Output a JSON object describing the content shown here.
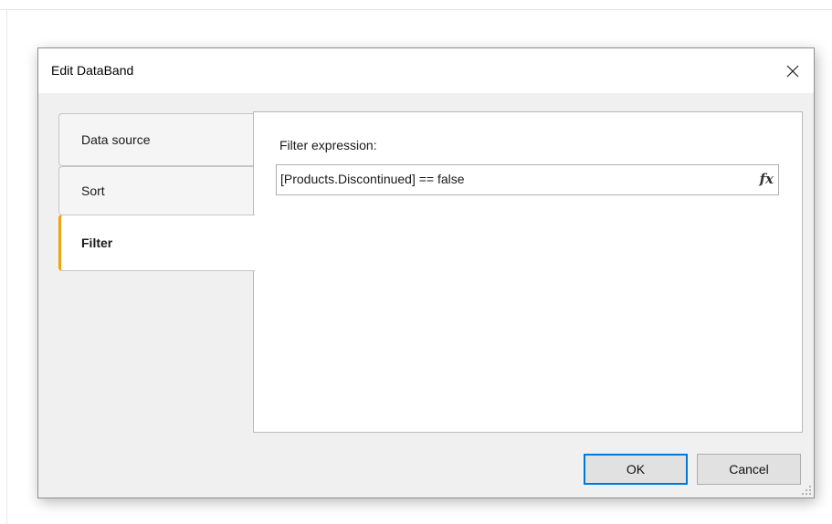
{
  "dialog": {
    "title": "Edit DataBand",
    "close_icon": "close-icon"
  },
  "tabs": [
    {
      "label": "Data source",
      "selected": false
    },
    {
      "label": "Sort",
      "selected": false
    },
    {
      "label": "Filter",
      "selected": true
    }
  ],
  "filter": {
    "label": "Filter expression:",
    "value": "[Products.Discontinued] == false",
    "fx_label": "fx"
  },
  "buttons": {
    "ok_label": "OK",
    "cancel_label": "Cancel"
  },
  "colors": {
    "accent": "#f0a30a",
    "focus": "#0078d7"
  }
}
